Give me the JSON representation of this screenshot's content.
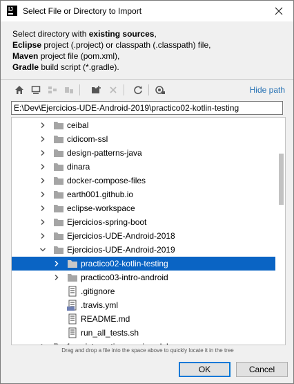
{
  "window": {
    "title": "Select File or Directory to Import",
    "app_icon_text": "IJ"
  },
  "description": {
    "line1_prefix": "Select directory with ",
    "line1_bold": "existing sources",
    "line1_suffix": ",",
    "line2_bold": "Eclipse",
    "line2_rest": " project (.project) or classpath (.classpath) file,",
    "line3_bold": "Maven",
    "line3_rest": " project file (pom.xml),",
    "line4_bold": "Gradle",
    "line4_rest": " build script (*.gradle)."
  },
  "toolbar": {
    "icons": [
      "home-icon",
      "desktop-icon",
      "project-icon",
      "module-icon",
      "new-folder-icon",
      "delete-icon",
      "refresh-icon",
      "show-hidden-icon"
    ],
    "hide_path_label": "Hide path"
  },
  "path": {
    "value": "E:\\Dev\\Ejercicios-UDE-Android-2019\\practico02-kotlin-testing"
  },
  "tree": {
    "rows": [
      {
        "label": "ceibal",
        "type": "folder",
        "expander": "collapsed",
        "depth": 1,
        "selected": false
      },
      {
        "label": "cidicom-ssl",
        "type": "folder",
        "expander": "collapsed",
        "depth": 1,
        "selected": false
      },
      {
        "label": "design-patterns-java",
        "type": "folder",
        "expander": "collapsed",
        "depth": 1,
        "selected": false
      },
      {
        "label": "dinara",
        "type": "folder",
        "expander": "collapsed",
        "depth": 1,
        "selected": false
      },
      {
        "label": "docker-compose-files",
        "type": "folder",
        "expander": "collapsed",
        "depth": 1,
        "selected": false
      },
      {
        "label": "earth001.github.io",
        "type": "folder",
        "expander": "collapsed",
        "depth": 1,
        "selected": false
      },
      {
        "label": "eclipse-workspace",
        "type": "folder",
        "expander": "collapsed",
        "depth": 1,
        "selected": false
      },
      {
        "label": "Ejercicios-spring-boot",
        "type": "folder",
        "expander": "collapsed",
        "depth": 1,
        "selected": false
      },
      {
        "label": "Ejercicios-UDE-Android-2018",
        "type": "folder",
        "expander": "collapsed",
        "depth": 1,
        "selected": false
      },
      {
        "label": "Ejercicios-UDE-Android-2019",
        "type": "folder",
        "expander": "expanded",
        "depth": 1,
        "selected": false
      },
      {
        "label": "practico02-kotlin-testing",
        "type": "folder",
        "expander": "collapsed",
        "depth": 2,
        "selected": true
      },
      {
        "label": "practico03-intro-android",
        "type": "folder",
        "expander": "collapsed",
        "depth": 2,
        "selected": false
      },
      {
        "label": ".gitignore",
        "type": "text-file",
        "expander": "none",
        "depth": 2,
        "selected": false
      },
      {
        "label": ".travis.yml",
        "type": "yml-file",
        "expander": "none",
        "depth": 2,
        "selected": false
      },
      {
        "label": "README.md",
        "type": "text-file",
        "expander": "none",
        "depth": 2,
        "selected": false
      },
      {
        "label": "run_all_tests.sh",
        "type": "text-file",
        "expander": "none",
        "depth": 2,
        "selected": false
      },
      {
        "label": "fuse-integration-services-labs",
        "type": "folder",
        "expander": "collapsed",
        "depth": 1,
        "selected": false
      }
    ]
  },
  "hint": "Drag and drop a file into the space above to quickly locate it in the tree",
  "buttons": {
    "ok": "OK",
    "cancel": "Cancel"
  },
  "colors": {
    "selection": "#0a64c4",
    "link": "#2470b3",
    "folder": "#a5a5a5"
  }
}
